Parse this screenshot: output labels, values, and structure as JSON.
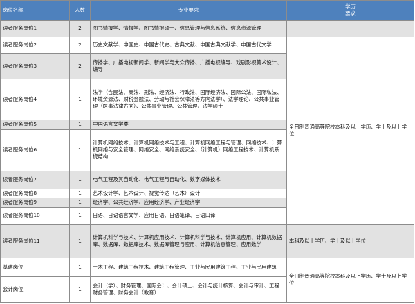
{
  "headers": {
    "position": "岗位名称",
    "count": "人数",
    "major": "专业要求",
    "education_line1": "学历",
    "education_line2": "要求"
  },
  "rows": [
    {
      "position": "读者服务岗位1",
      "count": "2",
      "major": "图书情报学、情报学、图书情报硕士、信息管理与信息系统、信息资源管理"
    },
    {
      "position": "读者服务岗位2",
      "count": "2",
      "major": "历史文献学、中国史、中国古代史、古典文献、中国古典文献学、中国古代文学"
    },
    {
      "position": "读者服务岗位3",
      "count": "2",
      "major": "传播学、广播电视新闻学、新闻学与大众传播、广播电视编导、戏剧影视美术设计、编导"
    },
    {
      "position": "读者服务岗位4",
      "count": "1",
      "major": "法学（含民法、商法、刑法、经济法、行政法、国际经济法、国际公法、国际私法、环境资源法、财税金融法、劳动与社会保障法等方向法学）、法学理论、公共事业管理（医事法律方向）、公共事业管理、公共管理、法学硕士"
    },
    {
      "position": "读者服务岗位5",
      "count": "1",
      "major": "中国语言文学类"
    },
    {
      "position": "读者服务岗位6",
      "count": "1",
      "major": "计算机网络技术、计算机网络技术与工程、计算机网络工程与管理、网络技术、计算机网络与安全管理、网络安全、网络系统安全、（计算机）网络工程技术、计算机系统结构"
    },
    {
      "position": "读者服务岗位7",
      "count": "1",
      "major": "电气工程及其自动化、电气工程与自动化、数字媒体技术"
    },
    {
      "position": "读者服务岗位8",
      "count": "1",
      "major": "艺术设计学、艺术设计、视觉传达（艺术）设计"
    },
    {
      "position": "读者服务岗位9",
      "count": "1",
      "major": "经济学、公共经济学、应用经济学、产业经济学"
    },
    {
      "position": "读者服务岗位10",
      "count": "1",
      "major": "日语、日语语言文学、应用日语、日语笔译、日语口译"
    },
    {
      "position": "读者服务岗位11",
      "count": "1",
      "major": "计算机科学与技术、计算机应用技术、计算机科学与技术、计算机应用、计算机数据库、数据库、数据库技术、数据库管理与应用、计算机信息管理、应用数学"
    },
    {
      "position": "基建岗位",
      "count": "1",
      "major": "土木工程、建筑工程技术、建筑工程管理、工业与民用建筑工程、工业与民用建筑"
    },
    {
      "position": "会计岗位",
      "count": "1",
      "major": "会计（学）、财务管理、国际会计、会计硕士、会计与统计核算、会计与审计、工程财务管理、财务会计（教育）"
    }
  ],
  "education": {
    "group_a": "全日制普通高等院校本科及以上学历、学士及以上学位",
    "group_b": "本科及以上学历、学士及以上学位",
    "group_c": "全日制普通高等院校本科及以上学历、学士及以上学位"
  }
}
